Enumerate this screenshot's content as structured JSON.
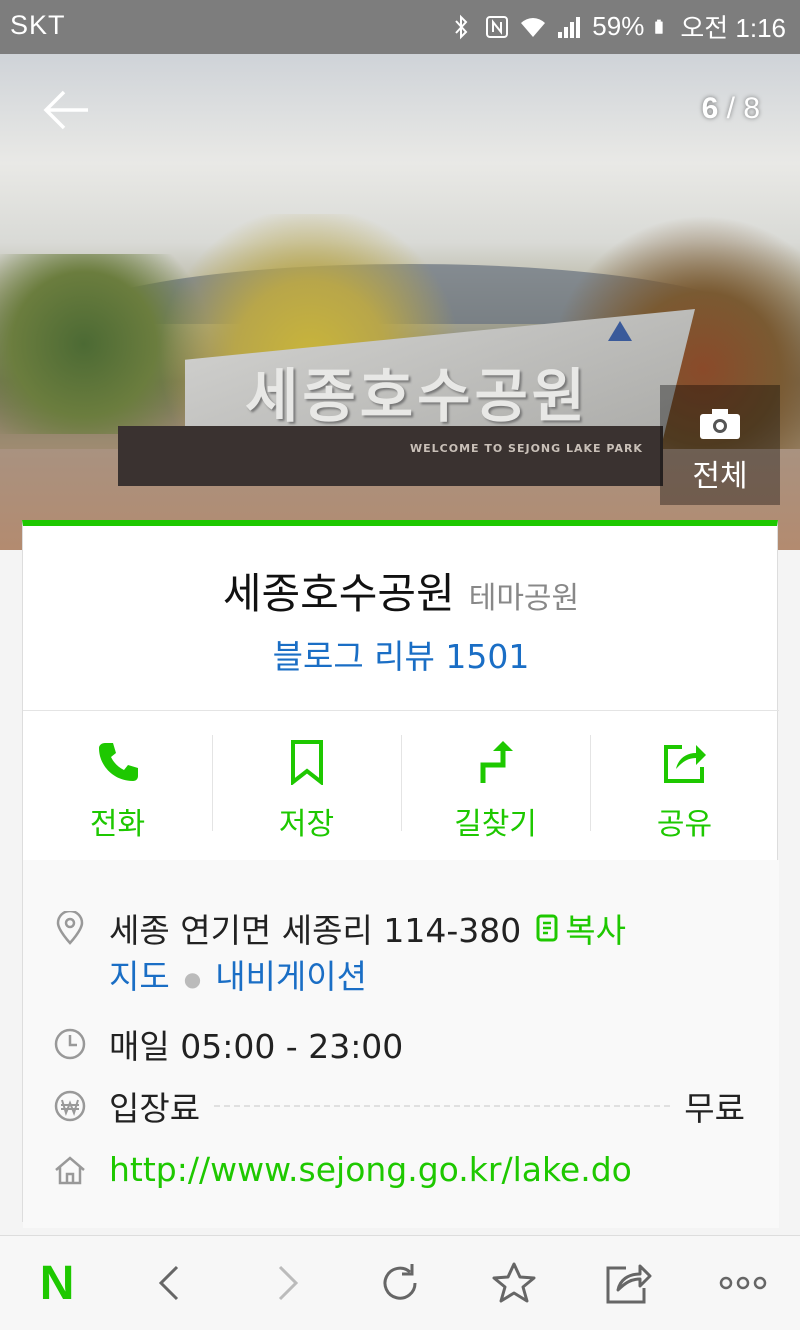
{
  "status_bar": {
    "carrier": "SKT",
    "battery": "59%",
    "time": "오전 1:16"
  },
  "gallery": {
    "current": "6",
    "separator": " / ",
    "total": "8",
    "all_label": "전체",
    "photo_sign_text": "세종호수공원",
    "photo_base_text": "WELCOME TO SEJONG LAKE PARK"
  },
  "place": {
    "name": "세종호수공원",
    "category": "테마공원",
    "review": "블로그 리뷰 1501"
  },
  "actions": [
    {
      "label": "전화",
      "icon": "phone-icon"
    },
    {
      "label": "저장",
      "icon": "bookmark-icon"
    },
    {
      "label": "길찾기",
      "icon": "directions-icon"
    },
    {
      "label": "공유",
      "icon": "share-icon"
    }
  ],
  "info": {
    "address": "세종 연기면 세종리 114-380",
    "copy_label": "복사",
    "map_link": "지도",
    "nav_link": "내비게이션",
    "hours": "매일 05:00 - 23:00",
    "fee_label": "입장료",
    "fee_value": "무료",
    "url": "http://www.sejong.go.kr/lake.do"
  },
  "colors": {
    "accent": "#1ec800",
    "link": "#1a6ec5"
  },
  "bottom_bar": [
    "naver-logo",
    "back-icon",
    "forward-icon",
    "refresh-icon",
    "star-icon",
    "share-icon",
    "more-icon"
  ]
}
